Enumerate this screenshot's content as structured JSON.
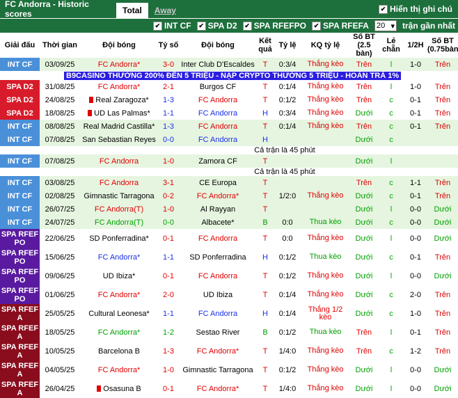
{
  "header": {
    "title": "FC Andorra - Historic scores",
    "tab_total": "Total",
    "tab_away": "Away",
    "show_notes": "Hiển thị ghi chú"
  },
  "filters": {
    "items": [
      "INT CF",
      "SPA D2",
      "SPA RFEFPO",
      "SPA RFEFA"
    ],
    "count": "20",
    "recent_label": "trận gần nhất"
  },
  "columns": {
    "league": "Giải đấu",
    "time": "Thời gian",
    "home": "Đội bóng",
    "score": "Tỷ số",
    "away": "Đội bóng",
    "result": "Kết quả",
    "ratio": "Tỷ lệ",
    "kq_ratio": "KQ tỷ lệ",
    "goals": "Số BT (2.5 bàn)",
    "odd_even": "Lẻ chẵn",
    "half": "1/2H",
    "goals75": "Số BT (0.75bàn)"
  },
  "colors": {
    "INT CF": "#4a90d9",
    "SPA D2": "#d81b2a",
    "SPA RFEFPO": "#5a1aa0",
    "SPA RFEFA": "#8a0d1e",
    "green_row": "#e6f5e0",
    "header_green": "#1d6f3c"
  },
  "ad": "B9CASINO THƯỞNG 200% ĐẾN 5 TRIỆU - NẠP CRYPTO THƯỞNG 5 TRIỆU - HOÀN TRẢ 1%",
  "note": "Cả trận là 45 phút",
  "rows": [
    {
      "league": "INT CF",
      "date": "03/09/25",
      "home": "FC Andorra*",
      "hc": "red",
      "score": "3-0",
      "sc": "red",
      "away": "Inter Club D'Escaldes",
      "ac": "",
      "res": "T",
      "rc": "win",
      "ratio": "0:3/4",
      "kq": "Thắng kèo",
      "kc": "win",
      "bt": "Trên",
      "btc": "win",
      "le": "l",
      "lc": "draw",
      "half": "1-0",
      "bt75": "Trên",
      "b7c": "win",
      "bg": "g"
    },
    {
      "type": "ad"
    },
    {
      "league": "SPA D2",
      "date": "31/08/25",
      "home": "FC Andorra*",
      "hc": "red",
      "score": "2-1",
      "sc": "red",
      "away": "Burgos CF",
      "ac": "",
      "res": "T",
      "rc": "win",
      "ratio": "0:1/4",
      "kq": "Thắng kèo",
      "kc": "win",
      "bt": "Trên",
      "btc": "win",
      "le": "l",
      "lc": "draw",
      "half": "1-0",
      "bt75": "Trên",
      "b7c": "win",
      "bg": "w"
    },
    {
      "league": "SPA D2",
      "date": "24/08/25",
      "home": "Real Zaragoza*",
      "hc": "",
      "flag": true,
      "score": "1-3",
      "sc": "blue",
      "away": "FC Andorra",
      "ac": "red",
      "res": "T",
      "rc": "win",
      "ratio": "0:1/2",
      "kq": "Thắng kèo",
      "kc": "win",
      "bt": "Trên",
      "btc": "win",
      "le": "c",
      "lc": "draw",
      "half": "0-1",
      "bt75": "Trên",
      "b7c": "win",
      "bg": "w"
    },
    {
      "league": "SPA D2",
      "date": "18/08/25",
      "home": "UD Las Palmas*",
      "hc": "",
      "flag": true,
      "score": "1-1",
      "sc": "blue",
      "away": "FC Andorra",
      "ac": "blue",
      "res": "H",
      "rc": "lose",
      "ratio": "0:3/4",
      "kq": "Thắng kèo",
      "kc": "win",
      "bt": "Dưới",
      "btc": "draw",
      "le": "c",
      "lc": "draw",
      "half": "0-1",
      "bt75": "Trên",
      "b7c": "win",
      "bg": "w"
    },
    {
      "league": "INT CF",
      "date": "08/08/25",
      "home": "Real Madrid Castilla*",
      "hc": "",
      "score": "1-3",
      "sc": "blue",
      "away": "FC Andorra",
      "ac": "red",
      "res": "T",
      "rc": "win",
      "ratio": "0:1/4",
      "kq": "Thắng kèo",
      "kc": "win",
      "bt": "Trên",
      "btc": "win",
      "le": "c",
      "lc": "draw",
      "half": "0-1",
      "bt75": "Trên",
      "b7c": "win",
      "bg": "g"
    },
    {
      "league": "INT CF",
      "date": "07/08/25",
      "home": "San Sebastian Reyes",
      "hc": "",
      "score": "0-0",
      "sc": "blue",
      "away": "FC Andorra",
      "ac": "blue",
      "res": "H",
      "rc": "lose",
      "ratio": "",
      "kq": "",
      "kc": "",
      "bt": "Dưới",
      "btc": "draw",
      "le": "c",
      "lc": "draw",
      "half": "",
      "bt75": "",
      "b7c": "",
      "bg": "g"
    },
    {
      "type": "note"
    },
    {
      "league": "INT CF",
      "date": "07/08/25",
      "home": "FC Andorra",
      "hc": "red",
      "score": "1-0",
      "sc": "red",
      "away": "Zamora CF",
      "ac": "",
      "res": "T",
      "rc": "win",
      "ratio": "",
      "kq": "",
      "kc": "",
      "bt": "Dưới",
      "btc": "draw",
      "le": "l",
      "lc": "draw",
      "half": "",
      "bt75": "",
      "b7c": "",
      "bg": "g"
    },
    {
      "type": "note"
    },
    {
      "league": "INT CF",
      "date": "03/08/25",
      "home": "FC Andorra",
      "hc": "red",
      "score": "3-1",
      "sc": "red",
      "away": "CE Europa",
      "ac": "",
      "res": "T",
      "rc": "win",
      "ratio": "",
      "kq": "",
      "kc": "",
      "bt": "Trên",
      "btc": "win",
      "le": "c",
      "lc": "draw",
      "half": "1-1",
      "bt75": "Trên",
      "b7c": "win",
      "bg": "g"
    },
    {
      "league": "INT CF",
      "date": "02/08/25",
      "home": "Gimnastic Tarragona",
      "hc": "",
      "score": "0-2",
      "sc": "red",
      "away": "FC Andorra*",
      "ac": "red",
      "res": "T",
      "rc": "win",
      "ratio": "1/2:0",
      "kq": "Thắng kèo",
      "kc": "win",
      "bt": "Dưới",
      "btc": "draw",
      "le": "c",
      "lc": "draw",
      "half": "0-1",
      "bt75": "Trên",
      "b7c": "win",
      "bg": "g"
    },
    {
      "league": "INT CF",
      "date": "26/07/25",
      "home": "FC Andorra(T)",
      "hc": "red",
      "score": "1-0",
      "sc": "red",
      "away": "Al Rayyan",
      "ac": "",
      "res": "T",
      "rc": "win",
      "ratio": "",
      "kq": "",
      "kc": "",
      "bt": "Dưới",
      "btc": "draw",
      "le": "l",
      "lc": "draw",
      "half": "0-0",
      "bt75": "Dưới",
      "b7c": "draw",
      "bg": "g"
    },
    {
      "league": "INT CF",
      "date": "24/07/25",
      "home": "FC Andorra(T)",
      "hc": "green",
      "score": "0-0",
      "sc": "green",
      "away": "Albacete*",
      "ac": "",
      "res": "B",
      "rc": "draw",
      "ratio": "0:0",
      "kq": "Thua kèo",
      "kc": "draw",
      "bt": "Dưới",
      "btc": "draw",
      "le": "c",
      "lc": "draw",
      "half": "0-0",
      "bt75": "Dưới",
      "b7c": "draw",
      "bg": "g"
    },
    {
      "league": "SPA RFEF PO",
      "date": "22/06/25",
      "home": "SD Ponferradina*",
      "hc": "",
      "score": "0-1",
      "sc": "red",
      "away": "FC Andorra",
      "ac": "red",
      "res": "T",
      "rc": "win",
      "ratio": "0:0",
      "kq": "Thắng kèo",
      "kc": "win",
      "bt": "Dưới",
      "btc": "draw",
      "le": "l",
      "lc": "draw",
      "half": "0-0",
      "bt75": "Dưới",
      "b7c": "draw",
      "bg": "w"
    },
    {
      "league": "SPA RFEF PO",
      "date": "15/06/25",
      "home": "FC Andorra*",
      "hc": "blue",
      "score": "1-1",
      "sc": "blue",
      "away": "SD Ponferradina",
      "ac": "",
      "res": "H",
      "rc": "lose",
      "ratio": "0:1/2",
      "kq": "Thua kèo",
      "kc": "draw",
      "bt": "Dưới",
      "btc": "draw",
      "le": "c",
      "lc": "draw",
      "half": "0-1",
      "bt75": "Trên",
      "b7c": "win",
      "bg": "w"
    },
    {
      "league": "SPA RFEF PO",
      "date": "09/06/25",
      "home": "UD Ibiza*",
      "hc": "",
      "score": "0-1",
      "sc": "red",
      "away": "FC Andorra",
      "ac": "red",
      "res": "T",
      "rc": "win",
      "ratio": "0:1/2",
      "kq": "Thắng kèo",
      "kc": "win",
      "bt": "Dưới",
      "btc": "draw",
      "le": "l",
      "lc": "draw",
      "half": "0-0",
      "bt75": "Dưới",
      "b7c": "draw",
      "bg": "w"
    },
    {
      "league": "SPA RFEF PO",
      "date": "01/06/25",
      "home": "FC Andorra*",
      "hc": "red",
      "score": "2-0",
      "sc": "red",
      "away": "UD Ibiza",
      "ac": "",
      "res": "T",
      "rc": "win",
      "ratio": "0:1/4",
      "kq": "Thắng kèo",
      "kc": "win",
      "bt": "Dưới",
      "btc": "draw",
      "le": "c",
      "lc": "draw",
      "half": "2-0",
      "bt75": "Trên",
      "b7c": "win",
      "bg": "w"
    },
    {
      "league": "SPA RFEF A",
      "date": "25/05/25",
      "home": "Cultural Leonesa*",
      "hc": "",
      "score": "1-1",
      "sc": "blue",
      "away": "FC Andorra",
      "ac": "blue",
      "res": "H",
      "rc": "lose",
      "ratio": "0:1/4",
      "kq": "Thắng 1/2 kèo",
      "kc": "win",
      "bt": "Dưới",
      "btc": "draw",
      "le": "c",
      "lc": "draw",
      "half": "1-0",
      "bt75": "Trên",
      "b7c": "win",
      "bg": "w"
    },
    {
      "league": "SPA RFEF A",
      "date": "18/05/25",
      "home": "FC Andorra*",
      "hc": "green",
      "score": "1-2",
      "sc": "green",
      "away": "Sestao River",
      "ac": "",
      "res": "B",
      "rc": "draw",
      "ratio": "0:1/2",
      "kq": "Thua kèo",
      "kc": "draw",
      "bt": "Trên",
      "btc": "win",
      "le": "l",
      "lc": "draw",
      "half": "0-1",
      "bt75": "Trên",
      "b7c": "win",
      "bg": "w"
    },
    {
      "league": "SPA RFEF A",
      "date": "10/05/25",
      "home": "Barcelona B",
      "hc": "",
      "score": "1-3",
      "sc": "red",
      "away": "FC Andorra*",
      "ac": "red",
      "res": "T",
      "rc": "win",
      "ratio": "1/4:0",
      "kq": "Thắng kèo",
      "kc": "win",
      "bt": "Trên",
      "btc": "win",
      "le": "c",
      "lc": "draw",
      "half": "1-2",
      "bt75": "Trên",
      "b7c": "win",
      "bg": "w"
    },
    {
      "league": "SPA RFEF A",
      "date": "04/05/25",
      "home": "FC Andorra*",
      "hc": "red",
      "score": "1-0",
      "sc": "red",
      "away": "Gimnastic Tarragona",
      "ac": "",
      "res": "T",
      "rc": "win",
      "ratio": "0:1/2",
      "kq": "Thắng kèo",
      "kc": "win",
      "bt": "Dưới",
      "btc": "draw",
      "le": "l",
      "lc": "draw",
      "half": "0-0",
      "bt75": "Dưới",
      "b7c": "draw",
      "bg": "w"
    },
    {
      "league": "SPA RFEF A",
      "date": "26/04/25",
      "home": "Osasuna B",
      "hc": "",
      "flag": true,
      "score": "0-1",
      "sc": "red",
      "away": "FC Andorra*",
      "ac": "red",
      "res": "T",
      "rc": "win",
      "ratio": "1/4:0",
      "kq": "Thắng kèo",
      "kc": "win",
      "bt": "Dưới",
      "btc": "draw",
      "le": "l",
      "lc": "draw",
      "half": "0-0",
      "bt75": "Dưới",
      "b7c": "draw",
      "bg": "w"
    }
  ]
}
